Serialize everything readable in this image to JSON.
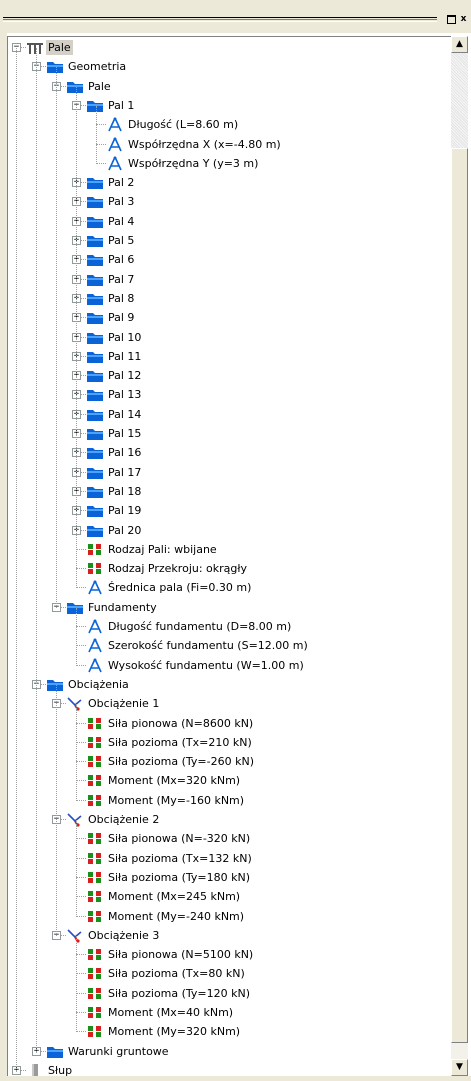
{
  "window": {
    "restore_label": "▫",
    "close_label": "x"
  },
  "tree": {
    "root": "Pale",
    "geometria": "Geometria",
    "pale": "Pale",
    "pal1": "Pal 1",
    "pal1_children": [
      "Długość (L=8.60 m)",
      "Współrzędna X (x=-4.80 m)",
      "Współrzędna Y (y=3 m)"
    ],
    "pales": [
      "Pal 2",
      "Pal 3",
      "Pal 4",
      "Pal 5",
      "Pal 6",
      "Pal 7",
      "Pal 8",
      "Pal 9",
      "Pal 10",
      "Pal 11",
      "Pal 12",
      "Pal 13",
      "Pal 14",
      "Pal 15",
      "Pal 16",
      "Pal 17",
      "Pal 18",
      "Pal 19",
      "Pal 20"
    ],
    "rodzaj_pali": "Rodzaj Pali: wbijane",
    "rodzaj_przekroju": "Rodzaj Przekroju: okrągły",
    "srednica": "Średnica pala (Fi=0.30 m)",
    "fundamenty": "Fundamenty",
    "fundamenty_children": [
      "Długość fundamentu (D=8.00 m)",
      "Szerokość fundamentu (S=12.00 m)",
      "Wysokość fundamentu (W=1.00 m)"
    ],
    "obciazenia": "Obciążenia",
    "loads": [
      {
        "name": "Obciążenie 1",
        "items": [
          "Siła pionowa (N=8600 kN)",
          "Siła pozioma (Tx=210 kN)",
          "Siła pozioma (Ty=-260 kN)",
          "Moment (Mx=320 kNm)",
          "Moment (My=-160 kNm)"
        ]
      },
      {
        "name": "Obciążenie 2",
        "items": [
          "Siła pionowa (N=-320 kN)",
          "Siła pozioma (Tx=132 kN)",
          "Siła pozioma (Ty=180 kN)",
          "Moment (Mx=245 kNm)",
          "Moment (My=-240 kNm)"
        ]
      },
      {
        "name": "Obciążenie 3",
        "items": [
          "Siła pionowa (N=5100 kN)",
          "Siła pozioma (Tx=80 kN)",
          "Siła pozioma (Ty=120 kN)",
          "Moment (Mx=40 kNm)",
          "Moment (My=320 kNm)"
        ]
      }
    ],
    "warunki": "Warunki gruntowe",
    "slup": "Słup"
  },
  "colors": {
    "folder": "#0a64d8",
    "folder_light": "#4aa3ff",
    "selection": "#d4d0c8"
  },
  "icons": {
    "root": "pile-icon",
    "folder": "folder-icon",
    "dimension": "compass-icon",
    "property": "property-icon",
    "load": "load-icon",
    "column": "column-icon"
  }
}
